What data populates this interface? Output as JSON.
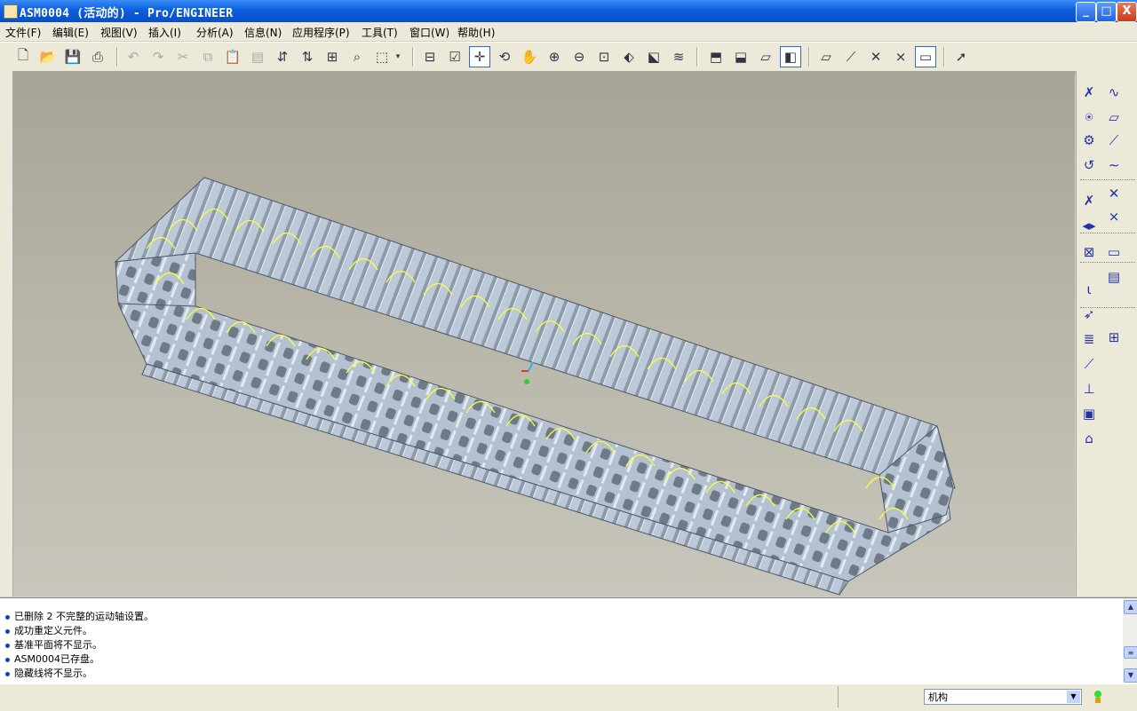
{
  "window": {
    "title": "ASM0004 (活动的) - Pro/ENGINEER",
    "controls": {
      "minimize": "_",
      "maximize": "□",
      "close": "X"
    }
  },
  "menubar": {
    "items": [
      "文件(F)",
      "编辑(E)",
      "视图(V)",
      "插入(I)",
      "分析(A)",
      "信息(N)",
      "应用程序(P)",
      "工具(T)",
      "窗口(W)",
      "帮助(H)"
    ]
  },
  "toolbar": {
    "icons": [
      "new-icon",
      "open-icon",
      "save-icon",
      "print-icon",
      "undo-icon",
      "redo-icon",
      "cut-icon",
      "copy-icon",
      "paste-icon",
      "paste-special-icon",
      "regenerate-icon",
      "regen-manager-icon",
      "search-tool-icon",
      "find-icon",
      "select-box-icon",
      "dropdown-icon",
      "model-tree-icon",
      "layers-icon",
      "spin-center-icon",
      "orient-icon",
      "pan-icon",
      "zoom-in-icon",
      "zoom-out-icon",
      "refit-icon",
      "reorient-icon",
      "view-manager-icon",
      "saved-views-icon",
      "wireframe-icon",
      "hidden-line-icon",
      "no-hidden-icon",
      "shading-icon",
      "datum-planes-icon",
      "datum-axes-icon",
      "datum-points-icon",
      "coord-systems-icon",
      "annotations-icon",
      "context-help-icon"
    ],
    "pressed": [
      "spin-center-icon",
      "shading-icon",
      "annotations-icon"
    ]
  },
  "right_toolbar": {
    "icons": [
      "mechanism-connect-icon",
      "analysis-curve-icon",
      "servo-motor-icon",
      "datum-plane-icon",
      "gear-pair-icon",
      "datum-axis-icon",
      "cam-icon",
      "sketch-curve-icon",
      "spring-icon",
      "datum-point-icon",
      "force-icon",
      "coord-sys-icon",
      "mechanism-analysis-icon",
      "measure-icon",
      "playback-icon",
      "measure-results-icon",
      "gravity-icon",
      "sensor-icon",
      "damper-icon",
      "table-icon",
      "joint-axis-icon",
      "drag-icon",
      "view-icon",
      "snapshot-icon"
    ]
  },
  "messages": [
    "已删除 2 不完整的运动轴设置。",
    "成功重定义元件。",
    "基准平面将不显示。",
    "ASM0004已存盘。",
    "隐藏线将不显示。"
  ],
  "status": {
    "filter_value": "机构"
  },
  "colors": {
    "title_bar": "#0b5ee0",
    "model_fill": "#b9c6d6",
    "model_edge": "#4f5966",
    "motion_symbols": "#ffff33",
    "background_top": "#a7a496",
    "background_bottom": "#c8c6bc"
  }
}
